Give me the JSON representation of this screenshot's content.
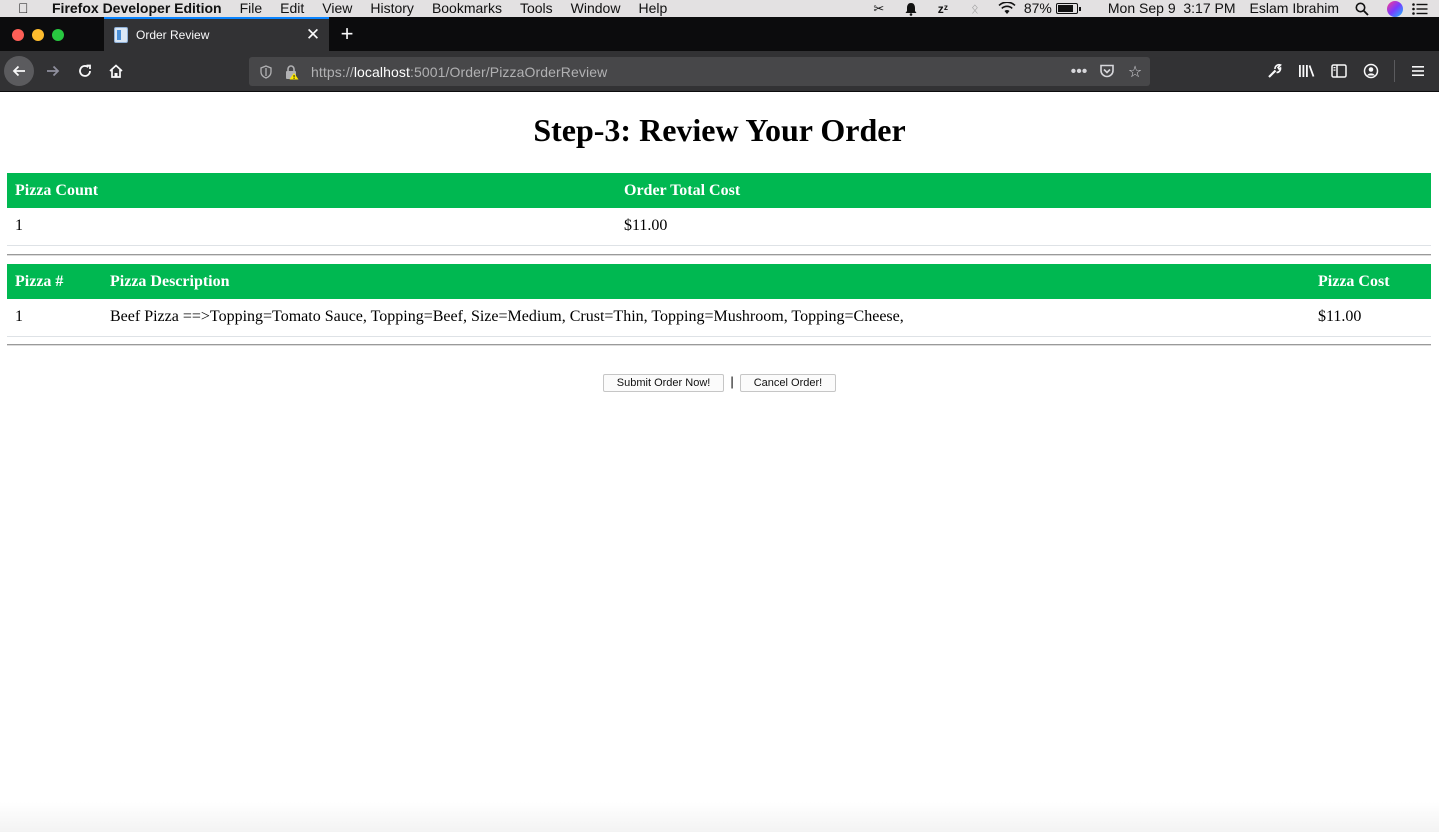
{
  "menubar": {
    "app_name": "Firefox Developer Edition",
    "items": [
      "File",
      "Edit",
      "View",
      "History",
      "Bookmarks",
      "Tools",
      "Window",
      "Help"
    ],
    "battery_percent": "87%",
    "battery_level": 0.87,
    "datetime": "Mon Sep 9  3:17 PM",
    "user": "Eslam Ibrahim"
  },
  "browser": {
    "tab_title": "Order Review",
    "url_prefix": "https://",
    "url_host": "localhost",
    "url_path": ":5001/Order/PizzaOrderReview"
  },
  "page": {
    "heading": "Step-3: Review Your Order",
    "summary_table": {
      "headers": [
        "Pizza Count",
        "Order Total Cost"
      ],
      "rows": [
        [
          "1",
          "$11.00"
        ]
      ]
    },
    "items_table": {
      "headers": [
        "Pizza #",
        "Pizza Description",
        "Pizza Cost"
      ],
      "rows": [
        [
          "1",
          "Beef Pizza ==>Topping=Tomato Sauce, Topping=Beef, Size=Medium, Crust=Thin, Topping=Mushroom, Topping=Cheese,",
          "$11.00"
        ]
      ]
    },
    "submit_label": "Submit Order Now!",
    "separator": "|",
    "cancel_label": "Cancel Order!"
  }
}
